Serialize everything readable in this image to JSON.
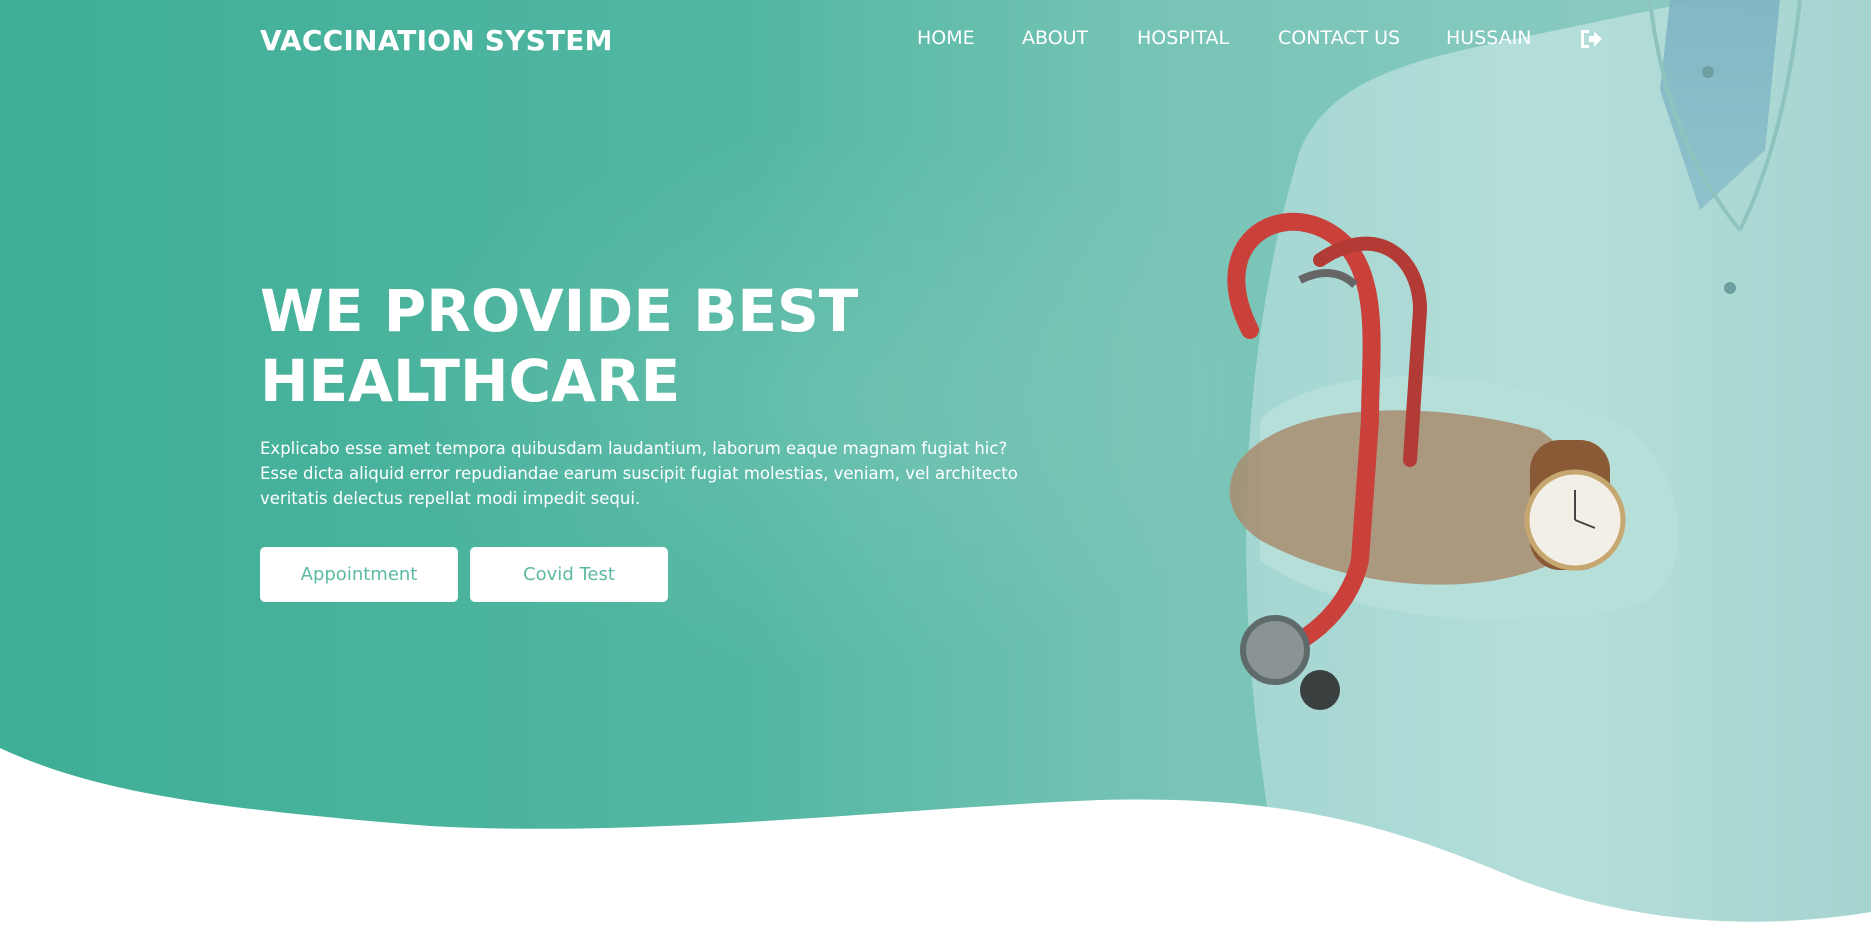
{
  "brand": {
    "title": "VACCINATION SYSTEM"
  },
  "nav": {
    "items": [
      {
        "label": "HOME"
      },
      {
        "label": "ABOUT"
      },
      {
        "label": "HOSPITAL"
      },
      {
        "label": "CONTACT US"
      },
      {
        "label": "HUSSAIN"
      }
    ],
    "logout_icon": "sign-out-icon"
  },
  "hero": {
    "headline_line1": "WE PROVIDE BEST",
    "headline_line2": "HEALTHCARE",
    "paragraph": "Explicabo esse amet tempora quibusdam laudantium, laborum eaque magnam fugiat hic? Esse dicta aliquid error repudiandae earum suscipit fugiat molestias, veniam, vel architecto veritatis delectus repellat modi impedit sequi.",
    "buttons": [
      {
        "label": "Appointment"
      },
      {
        "label": "Covid Test"
      }
    ],
    "image": "doctor-with-stethoscope"
  },
  "colors": {
    "primary": "#4fb39e",
    "button_text": "#5cb9a2",
    "white": "#ffffff"
  }
}
